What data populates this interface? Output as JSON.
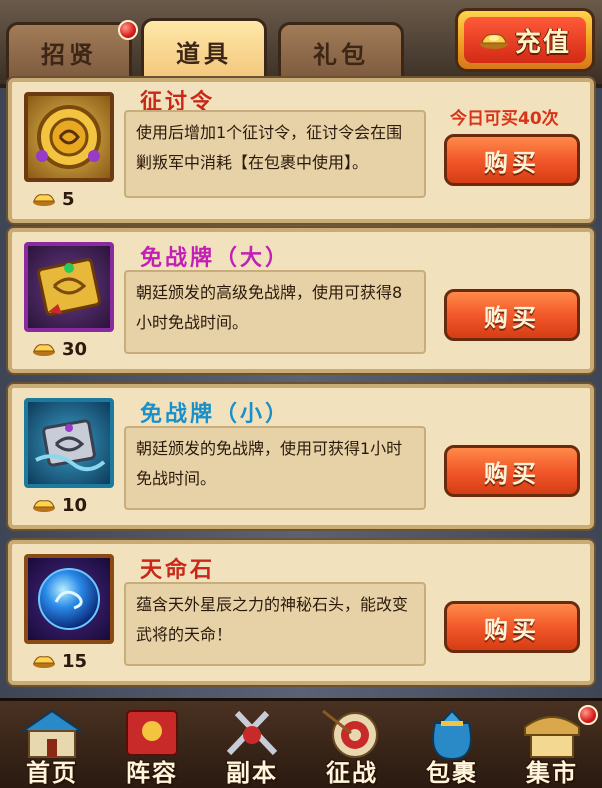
{
  "tabs": [
    {
      "label": "招贤",
      "active": false,
      "badge": true
    },
    {
      "label": "道具",
      "active": true,
      "badge": false
    },
    {
      "label": "礼包",
      "active": false,
      "badge": false
    }
  ],
  "recharge_label": "充值",
  "items": [
    {
      "title": "征讨令",
      "title_color": "#c8281a",
      "icon": "token-coin-icon",
      "description": "使用后增加1个征讨令，征讨令会在围剿叛军中消耗【在包裹中使用】。",
      "price": "5",
      "limit": "今日可买40次",
      "buy_label": "购买"
    },
    {
      "title": "免战牌（大）",
      "title_color": "#c21fb4",
      "icon": "large-truce-plaque-icon",
      "description": "朝廷颁发的高级免战牌，使用可获得8小时免战时间。",
      "price": "30",
      "limit": "",
      "buy_label": "购买"
    },
    {
      "title": "免战牌（小）",
      "title_color": "#1a8fc8",
      "icon": "small-truce-plaque-icon",
      "description": "朝廷颁发的免战牌，使用可获得1小时免战时间。",
      "price": "10",
      "limit": "",
      "buy_label": "购买"
    },
    {
      "title": "天命石",
      "title_color": "#c8281a",
      "icon": "destiny-stone-icon",
      "description": "蕴含天外星辰之力的神秘石头，能改变武将的天命！",
      "price": "15",
      "limit": "",
      "buy_label": "购买"
    }
  ],
  "nav": [
    {
      "label": "首页",
      "icon": "home-building-icon",
      "badge": false
    },
    {
      "label": "阵容",
      "icon": "lineup-banner-icon",
      "badge": false
    },
    {
      "label": "副本",
      "icon": "dungeon-swords-icon",
      "badge": false
    },
    {
      "label": "征战",
      "icon": "campaign-target-icon",
      "badge": false
    },
    {
      "label": "包裹",
      "icon": "bag-icon",
      "badge": false
    },
    {
      "label": "集市",
      "icon": "market-icon",
      "badge": true
    }
  ],
  "colors": {
    "accent": "#f2582a",
    "gold": "#f0a022",
    "card_bg": "#f1e2bd"
  }
}
